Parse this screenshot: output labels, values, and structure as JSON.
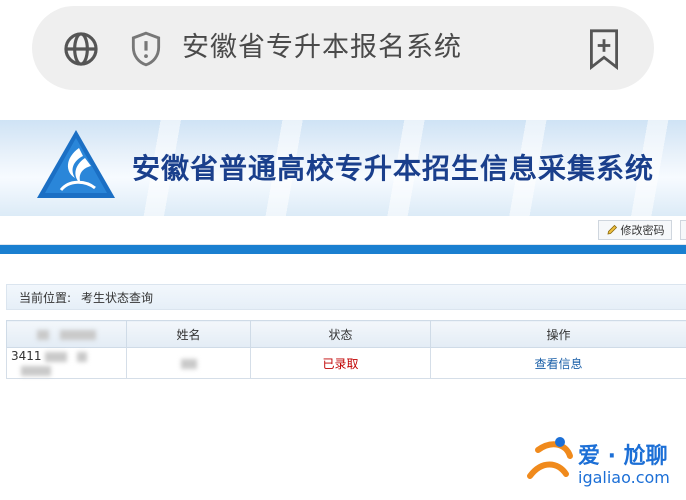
{
  "browser": {
    "address_text": "安徽省专升本报名系统",
    "icons": [
      "globe-icon",
      "shield-alert-icon",
      "add-bookmark-icon"
    ]
  },
  "banner": {
    "title": "安徽省普通高校专升本招生信息采集系统"
  },
  "toolbar": {
    "change_password_label": "修改密码"
  },
  "breadcrumb": {
    "label": "当前位置:",
    "value": "考生状态查询"
  },
  "table": {
    "columns": [
      "",
      "姓名",
      "状态",
      "操作"
    ],
    "rows": [
      {
        "id_prefix": "3411",
        "status": "已录取",
        "action": "查看信息"
      }
    ]
  },
  "watermark": {
    "text": "爱 · 尬聊",
    "url": "igaliao.com"
  },
  "colors": {
    "accent_blue": "#1a7fd0",
    "status_red": "#c00000",
    "link_blue": "#1a5fa8",
    "title_blue": "#1a3f8c"
  }
}
